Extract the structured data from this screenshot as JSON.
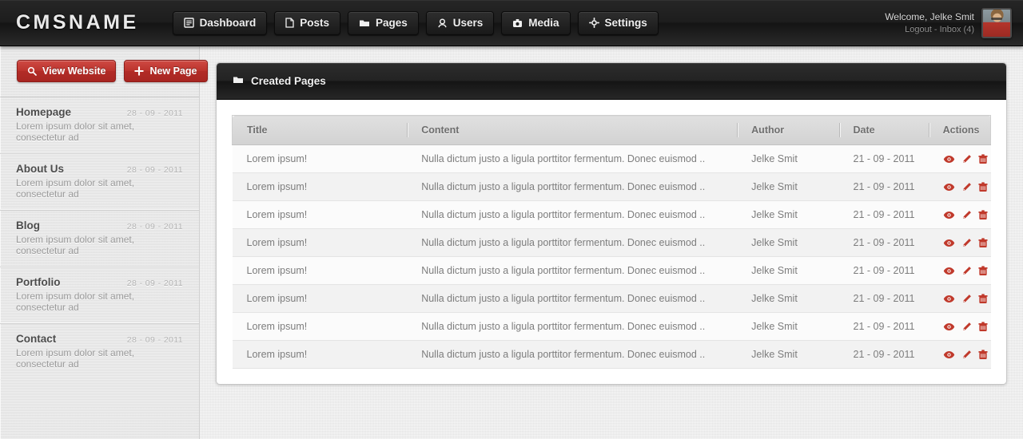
{
  "header": {
    "logo": "CMSNAME",
    "nav": [
      {
        "label": "Dashboard",
        "icon": "dashboard-icon"
      },
      {
        "label": "Posts",
        "icon": "file-icon"
      },
      {
        "label": "Pages",
        "icon": "folder-icon"
      },
      {
        "label": "Users",
        "icon": "user-icon"
      },
      {
        "label": "Media",
        "icon": "camera-icon"
      },
      {
        "label": "Settings",
        "icon": "gear-icon"
      }
    ],
    "user": {
      "welcome": "Welcome, Jelke Smit",
      "links": "Logout - Inbox (4)"
    }
  },
  "sidebar": {
    "buttons": [
      {
        "label": "View Website",
        "icon": "search-icon"
      },
      {
        "label": "New Page",
        "icon": "plus-icon"
      }
    ],
    "items": [
      {
        "title": "Homepage",
        "date": "28 - 09 - 2011",
        "desc": "Lorem ipsum dolor sit amet, consectetur ad"
      },
      {
        "title": "About Us",
        "date": "28 - 09 - 2011",
        "desc": "Lorem ipsum dolor sit amet, consectetur ad"
      },
      {
        "title": "Blog",
        "date": "28 - 09 - 2011",
        "desc": "Lorem ipsum dolor sit amet, consectetur ad"
      },
      {
        "title": "Portfolio",
        "date": "28 - 09 - 2011",
        "desc": "Lorem ipsum dolor sit amet, consectetur ad"
      },
      {
        "title": "Contact",
        "date": "28 - 09 - 2011",
        "desc": "Lorem ipsum dolor sit amet, consectetur ad"
      }
    ]
  },
  "panel": {
    "title": "Created Pages",
    "icon": "folder-icon",
    "columns": [
      "Title",
      "Content",
      "Author",
      "Date",
      "Actions"
    ],
    "row_actions": [
      "view-icon",
      "edit-icon",
      "delete-icon"
    ],
    "rows": [
      {
        "title": "Lorem ipsum!",
        "content": "Nulla dictum justo a ligula porttitor fermentum. Donec euismod ..",
        "author": "Jelke Smit",
        "date": "21 - 09 - 2011"
      },
      {
        "title": "Lorem ipsum!",
        "content": "Nulla dictum justo a ligula porttitor fermentum. Donec euismod ..",
        "author": "Jelke Smit",
        "date": "21 - 09 - 2011"
      },
      {
        "title": "Lorem ipsum!",
        "content": "Nulla dictum justo a ligula porttitor fermentum. Donec euismod ..",
        "author": "Jelke Smit",
        "date": "21 - 09 - 2011"
      },
      {
        "title": "Lorem ipsum!",
        "content": "Nulla dictum justo a ligula porttitor fermentum. Donec euismod ..",
        "author": "Jelke Smit",
        "date": "21 - 09 - 2011"
      },
      {
        "title": "Lorem ipsum!",
        "content": "Nulla dictum justo a ligula porttitor fermentum. Donec euismod ..",
        "author": "Jelke Smit",
        "date": "21 - 09 - 2011"
      },
      {
        "title": "Lorem ipsum!",
        "content": "Nulla dictum justo a ligula porttitor fermentum. Donec euismod ..",
        "author": "Jelke Smit",
        "date": "21 - 09 - 2011"
      },
      {
        "title": "Lorem ipsum!",
        "content": "Nulla dictum justo a ligula porttitor fermentum. Donec euismod ..",
        "author": "Jelke Smit",
        "date": "21 - 09 - 2011"
      },
      {
        "title": "Lorem ipsum!",
        "content": "Nulla dictum justo a ligula porttitor fermentum. Donec euismod ..",
        "author": "Jelke Smit",
        "date": "21 - 09 - 2011"
      }
    ]
  },
  "colors": {
    "accent_red": "#bb332d",
    "header_dark": "#1d1d1d",
    "body_bg": "#e8e8e8"
  }
}
